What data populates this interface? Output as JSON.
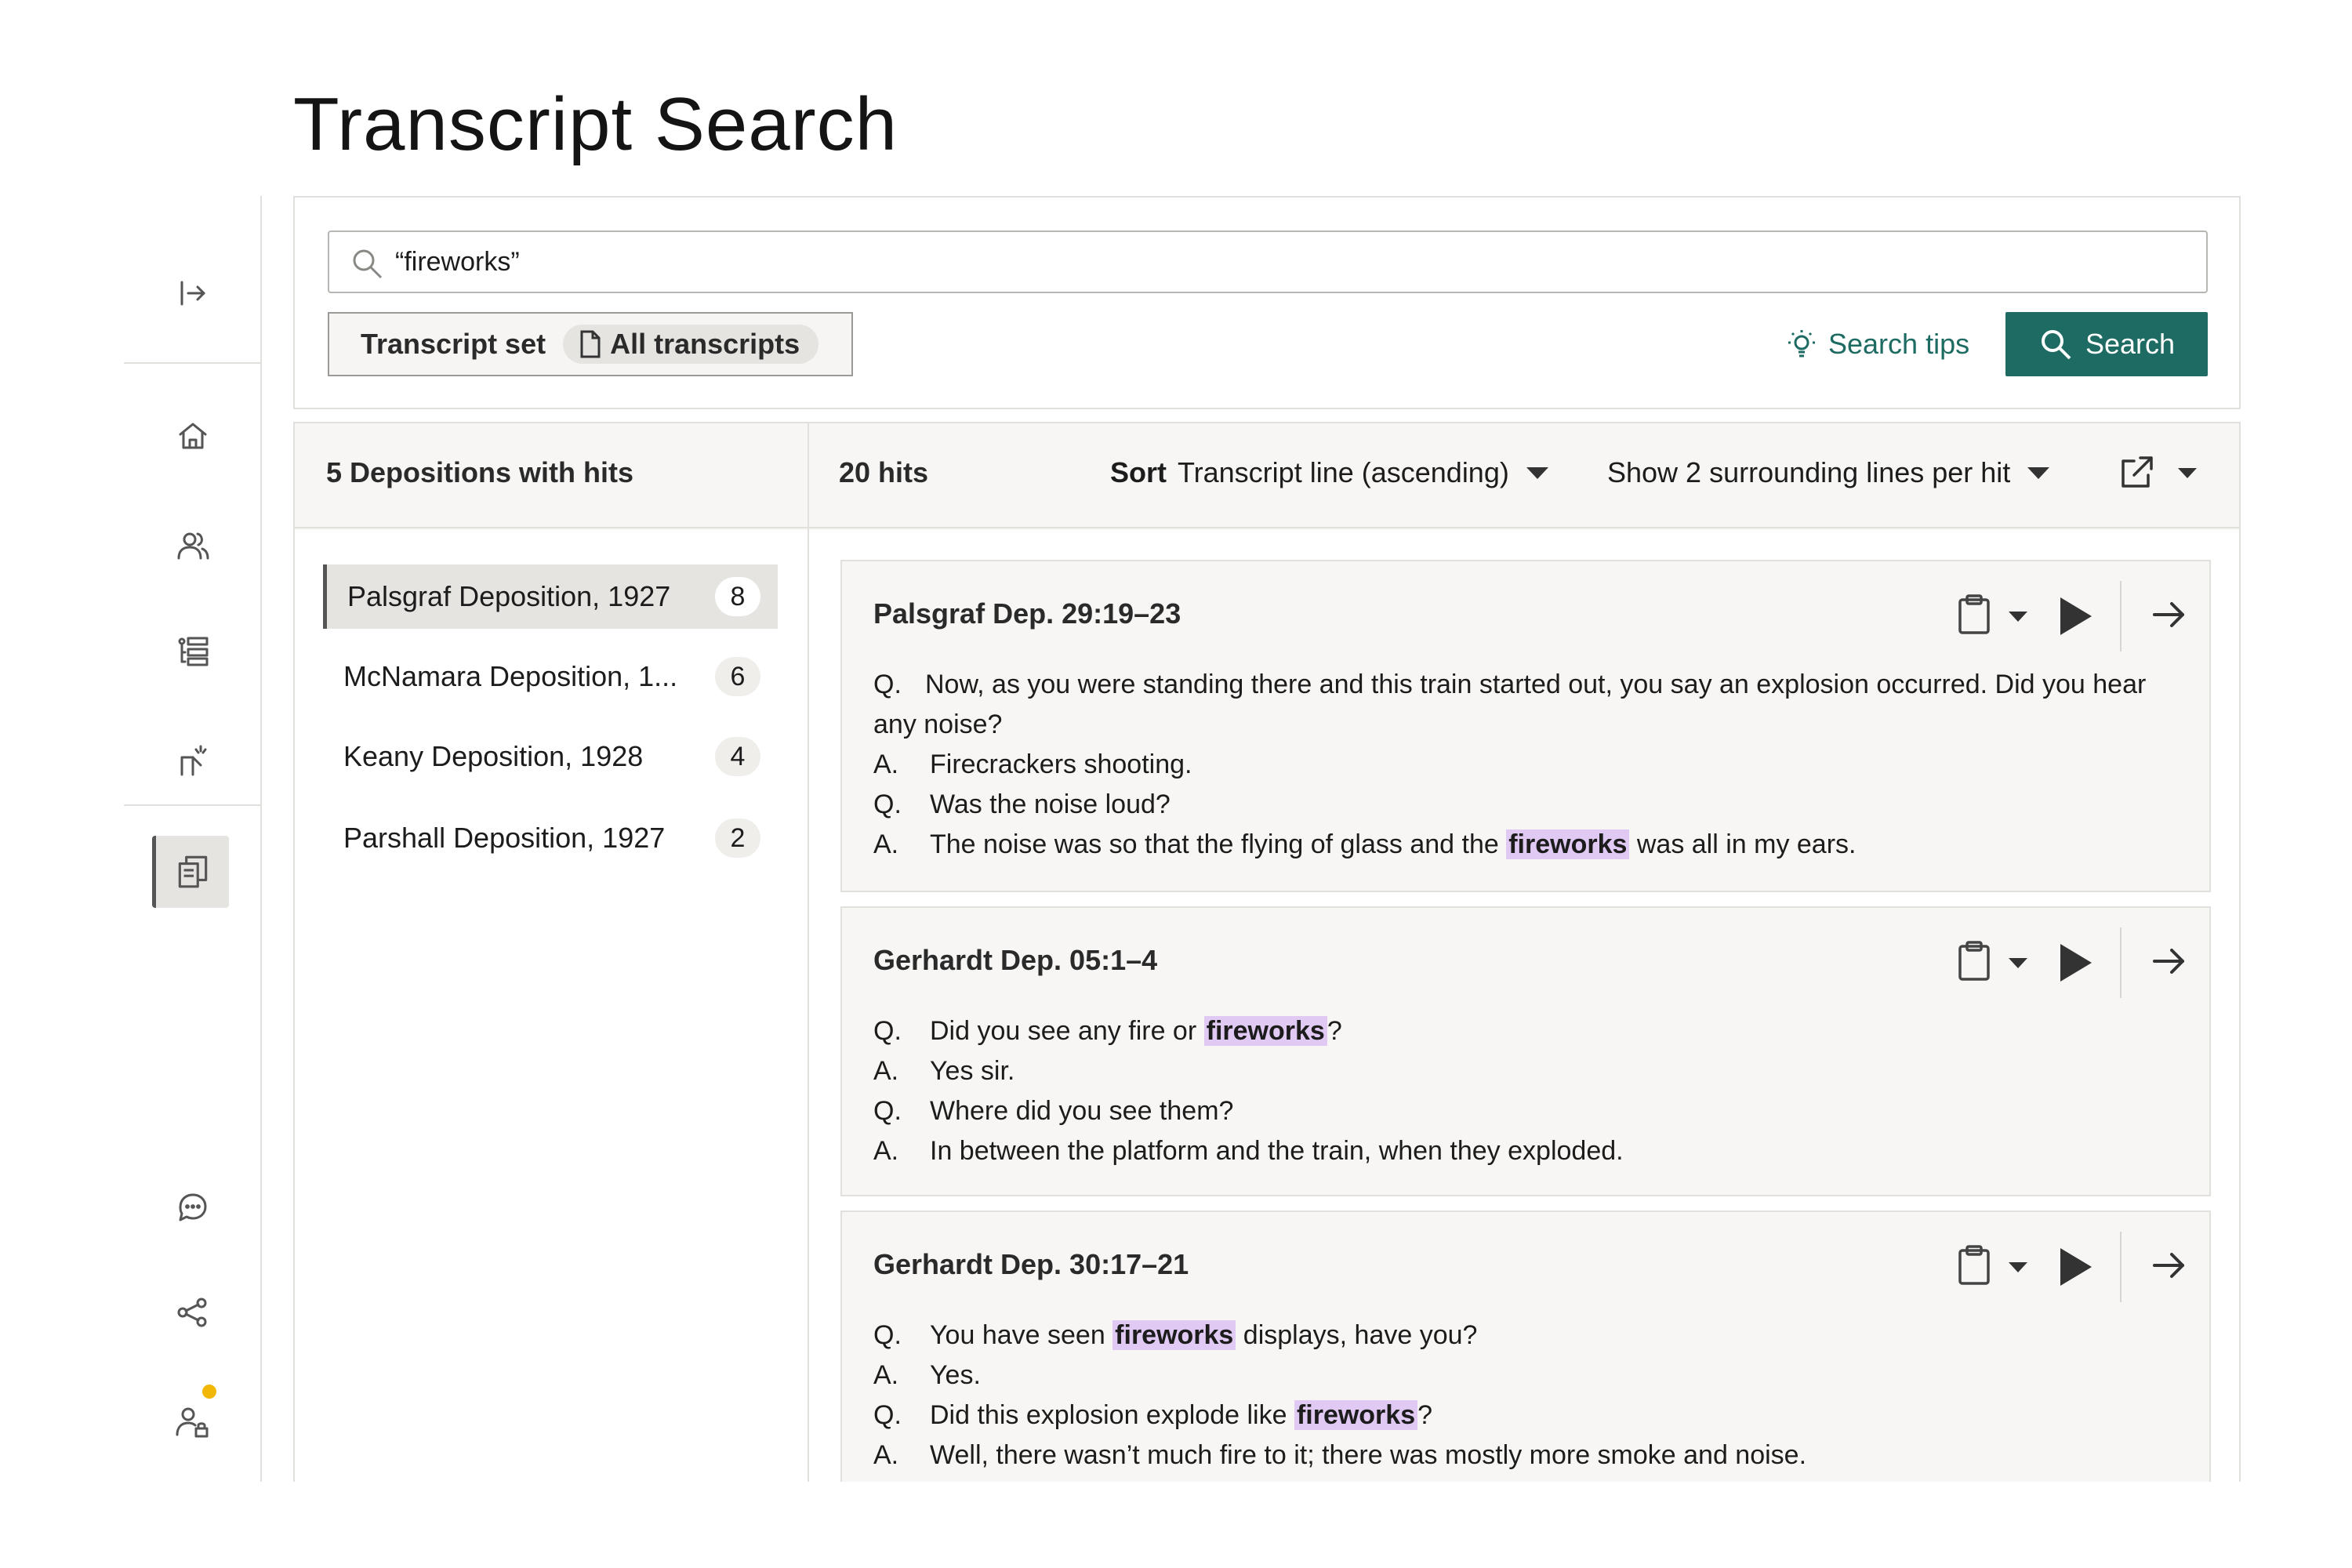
{
  "page": {
    "title": "Transcript Search"
  },
  "search": {
    "query": "“fireworks”",
    "transcript_set_label": "Transcript set",
    "transcript_set_value": "All transcripts",
    "tips_label": "Search tips",
    "search_label": "Search"
  },
  "results": {
    "depositions_summary": "5 Depositions with hits",
    "hits_summary": "20 hits",
    "sort_label": "Sort",
    "sort_value": "Transcript line (ascending)",
    "surrounding_value": "Show 2 surrounding lines per hit",
    "depositions": [
      {
        "name": "Palsgraf Deposition, 1927",
        "count": "8"
      },
      {
        "name": "McNamara Deposition, 1...",
        "count": "6"
      },
      {
        "name": "Keany Deposition, 1928",
        "count": "4"
      },
      {
        "name": "Parshall Deposition, 1927",
        "count": "2"
      }
    ],
    "hits": [
      {
        "title": "Palsgraf Dep. 29:19–23",
        "lines": [
          {
            "speaker": "Q.",
            "pre": "Now, as you were standing there and this train started out, you say an explosion occurred. Did you hear any noise?"
          },
          {
            "speaker": "A.",
            "pre": "Firecrackers shooting."
          },
          {
            "speaker": "Q.",
            "pre": "Was the noise loud?"
          },
          {
            "speaker": "A.",
            "pre": "The noise was so that the flying of glass and the ",
            "hl": "fireworks",
            "post": " was all in my ears."
          }
        ]
      },
      {
        "title": "Gerhardt Dep. 05:1–4",
        "lines": [
          {
            "speaker": "Q.",
            "pre": "Did you see any fire or ",
            "hl": "fireworks",
            "post": "?"
          },
          {
            "speaker": "A.",
            "pre": "Yes sir."
          },
          {
            "speaker": "Q.",
            "pre": "Where did you see them?"
          },
          {
            "speaker": "A.",
            "pre": "In between the platform and the train, when they exploded."
          }
        ]
      },
      {
        "title": "Gerhardt Dep. 30:17–21",
        "lines": [
          {
            "speaker": "Q.",
            "pre": "You have seen ",
            "hl": "fireworks",
            "post": " displays, have you?"
          },
          {
            "speaker": "A.",
            "pre": "Yes."
          },
          {
            "speaker": "Q.",
            "pre": "Did this explosion explode like ",
            "hl": "fireworks",
            "post": "?"
          },
          {
            "speaker": "A.",
            "pre": "Well, there wasn’t much fire to it; there was mostly more smoke and noise."
          }
        ]
      }
    ]
  },
  "colors": {
    "accent": "#1d6b62",
    "highlight": "#e0c9f2",
    "notification": "#f2b705"
  },
  "icons": {
    "rail": [
      "expand-sidebar-icon",
      "home-icon",
      "people-icon",
      "list-icon",
      "pointer-icon",
      "transcripts-icon",
      "chat-icon",
      "share-icon",
      "user-lock-icon"
    ]
  }
}
